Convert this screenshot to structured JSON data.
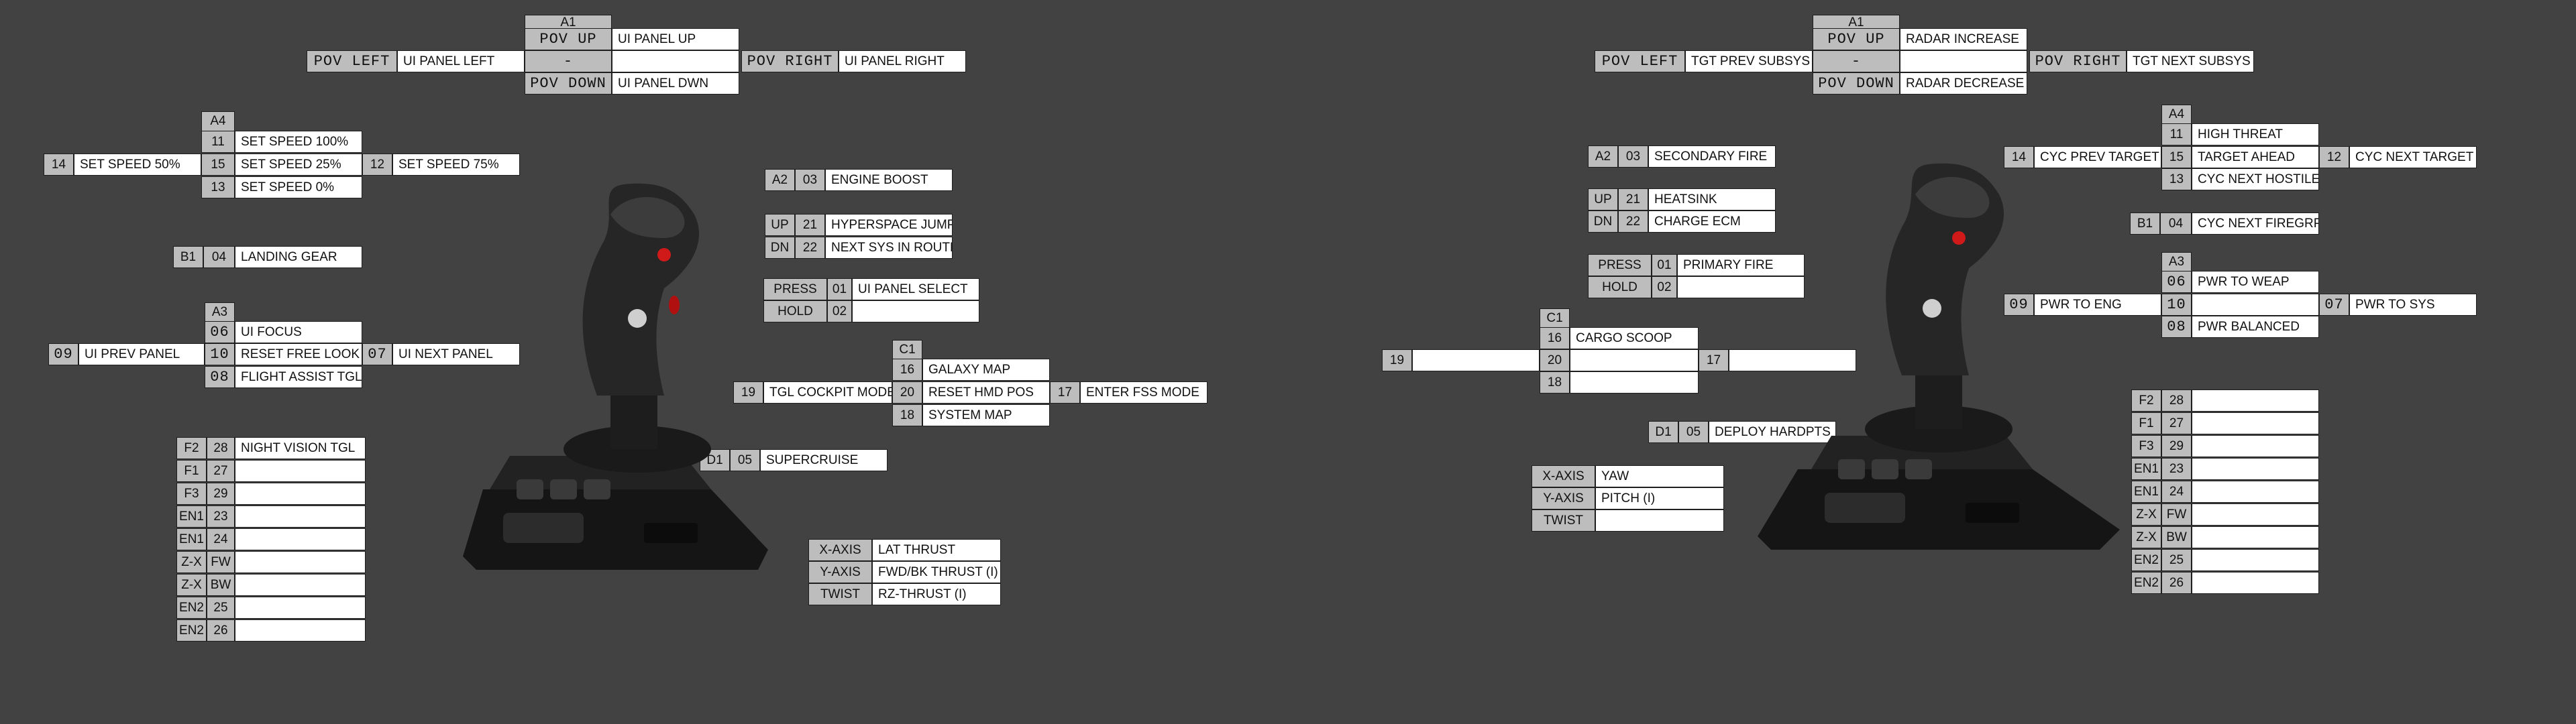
{
  "left": {
    "hat_a1": {
      "id": "A1",
      "up_key": "POV UP",
      "up": "UI PANEL UP",
      "left_key": "POV LEFT",
      "left": "UI PANEL LEFT",
      "press_key": "-",
      "press": "",
      "down_key": "POV DOWN",
      "down": "UI PANEL DWN",
      "right_key": "POV RIGHT",
      "right": "UI PANEL RIGHT"
    },
    "hat_a4": {
      "id": "A4",
      "up_key": "11",
      "up": "SET SPEED 100%",
      "left_key": "14",
      "left": "SET SPEED 50%",
      "press_key": "15",
      "press": "SET SPEED 25%",
      "down_key": "13",
      "down": "SET SPEED 0%",
      "right_key": "12",
      "right": "SET SPEED 75%"
    },
    "b1": {
      "id": "B1",
      "key": "04",
      "label": "LANDING GEAR"
    },
    "hat_a3": {
      "id": "A3",
      "up_key": "06",
      "up": "UI FOCUS",
      "left_key": "09",
      "left": "UI PREV PANEL",
      "press_key": "10",
      "press": "RESET FREE LOOK",
      "down_key": "08",
      "down": "FLIGHT ASSIST TGL",
      "right_key": "07",
      "right": "UI NEXT PANEL"
    },
    "base": [
      {
        "id": "F2",
        "key": "28",
        "label": "NIGHT VISION TGL"
      },
      {
        "id": "F1",
        "key": "27",
        "label": ""
      },
      {
        "id": "F3",
        "key": "29",
        "label": ""
      },
      {
        "id": "EN1",
        "key": "23",
        "label": ""
      },
      {
        "id": "EN1",
        "key": "24",
        "label": ""
      },
      {
        "id": "Z-X",
        "key": "FW",
        "label": ""
      },
      {
        "id": "Z-X",
        "key": "BW",
        "label": ""
      },
      {
        "id": "EN2",
        "key": "25",
        "label": ""
      },
      {
        "id": "EN2",
        "key": "26",
        "label": ""
      }
    ],
    "a2": {
      "id": "A2",
      "key": "03",
      "label": "ENGINE BOOST"
    },
    "updn": [
      {
        "id": "UP",
        "key": "21",
        "label": "HYPERSPACE JUMP"
      },
      {
        "id": "DN",
        "key": "22",
        "label": "NEXT SYS IN ROUTE"
      }
    ],
    "trigger": [
      {
        "id": "PRESS",
        "key": "01",
        "label": "UI PANEL SELECT"
      },
      {
        "id": "HOLD",
        "key": "02",
        "label": ""
      }
    ],
    "hat_c1": {
      "id": "C1",
      "up_key": "16",
      "up": "GALAXY MAP",
      "left_key": "19",
      "left": "TGL COCKPIT MODE",
      "press_key": "20",
      "press": "RESET HMD POS",
      "down_key": "18",
      "down": "SYSTEM MAP",
      "right_key": "17",
      "right": "ENTER FSS MODE"
    },
    "d1": {
      "id": "D1",
      "key": "05",
      "label": "SUPERCRUISE"
    },
    "axes": [
      {
        "id": "X-AXIS",
        "label": "LAT THRUST"
      },
      {
        "id": "Y-AXIS",
        "label": "FWD/BK THRUST (I)"
      },
      {
        "id": "TWIST",
        "label": "RZ-THRUST (I)"
      }
    ]
  },
  "right": {
    "hat_a1": {
      "id": "A1",
      "up_key": "POV UP",
      "up": "RADAR INCREASE",
      "left_key": "POV LEFT",
      "left": "TGT PREV SUBSYS",
      "press_key": "-",
      "press": "",
      "down_key": "POV DOWN",
      "down": "RADAR DECREASE",
      "right_key": "POV RIGHT",
      "right": "TGT NEXT SUBSYS"
    },
    "a2": {
      "id": "A2",
      "key": "03",
      "label": "SECONDARY FIRE"
    },
    "updn": [
      {
        "id": "UP",
        "key": "21",
        "label": "HEATSINK"
      },
      {
        "id": "DN",
        "key": "22",
        "label": "CHARGE ECM"
      }
    ],
    "trigger": [
      {
        "id": "PRESS",
        "key": "01",
        "label": "PRIMARY FIRE"
      },
      {
        "id": "HOLD",
        "key": "02",
        "label": ""
      }
    ],
    "hat_c1": {
      "id": "C1",
      "up_key": "16",
      "up": "CARGO SCOOP",
      "left_key": "19",
      "left": "",
      "press_key": "20",
      "press": "",
      "down_key": "18",
      "down": "",
      "right_key": "17",
      "right": ""
    },
    "d1": {
      "id": "D1",
      "key": "05",
      "label": "DEPLOY HARDPTS"
    },
    "axes": [
      {
        "id": "X-AXIS",
        "label": "YAW"
      },
      {
        "id": "Y-AXIS",
        "label": "PITCH   (I)"
      },
      {
        "id": "TWIST",
        "label": ""
      }
    ],
    "hat_a4": {
      "id": "A4",
      "up_key": "11",
      "up": "HIGH THREAT",
      "left_key": "14",
      "left": "CYC PREV TARGET",
      "press_key": "15",
      "press": "TARGET AHEAD",
      "down_key": "13",
      "down": "CYC NEXT HOSTILE",
      "right_key": "12",
      "right": "CYC NEXT TARGET"
    },
    "b1": {
      "id": "B1",
      "key": "04",
      "label": "CYC NEXT FIREGRP"
    },
    "hat_a3": {
      "id": "A3",
      "up_key": "06",
      "up": "PWR TO WEAP",
      "left_key": "09",
      "left": "PWR TO ENG",
      "press_key": "10",
      "press": "",
      "down_key": "08",
      "down": "PWR BALANCED",
      "right_key": "07",
      "right": "PWR TO SYS"
    },
    "base": [
      {
        "id": "F2",
        "key": "28",
        "label": ""
      },
      {
        "id": "F1",
        "key": "27",
        "label": ""
      },
      {
        "id": "F3",
        "key": "29",
        "label": ""
      },
      {
        "id": "EN1",
        "key": "23",
        "label": ""
      },
      {
        "id": "EN1",
        "key": "24",
        "label": ""
      },
      {
        "id": "Z-X",
        "key": "FW",
        "label": ""
      },
      {
        "id": "Z-X",
        "key": "BW",
        "label": ""
      },
      {
        "id": "EN2",
        "key": "25",
        "label": ""
      },
      {
        "id": "EN2",
        "key": "26",
        "label": ""
      }
    ]
  }
}
